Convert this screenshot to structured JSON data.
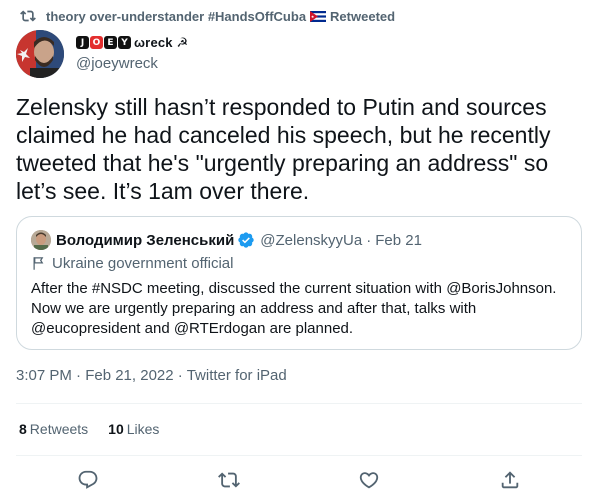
{
  "retweet": {
    "user": "theory over-understander #HandsOffCuba",
    "flag": "cuba-flag",
    "action": "Retweeted",
    "icon": "retweet-icon"
  },
  "author": {
    "name_tiles": [
      "J",
      "O",
      "E",
      "Y"
    ],
    "name_rest": "ωreck ☭",
    "handle": "@joeywreck"
  },
  "tweet": {
    "text": "Zelensky still hasn’t responded to Putin and sources claimed he had canceled his speech, but he recently tweeted that he's \"urgently preparing an address\" so let’s see. It’s 1am over there."
  },
  "quote": {
    "name": "Володимир Зеленський",
    "handle": "@ZelenskyyUa",
    "separator": "·",
    "date": "Feb 21",
    "label": "Ukraine government official",
    "text": "After the #NSDC meeting, discussed the current situation with @BorisJohnson. Now we are urgently preparing an address and after that, talks with @eucopresident and @RTErdogan are planned."
  },
  "meta": {
    "time": "3:07 PM",
    "separator": "·",
    "date": "Feb 21, 2022",
    "source": "Twitter for iPad"
  },
  "stats": {
    "retweets_count": "8",
    "retweets_label": "Retweets",
    "likes_count": "10",
    "likes_label": "Likes"
  },
  "actions": [
    "reply-icon",
    "retweet-icon",
    "like-icon",
    "share-icon"
  ],
  "colors": {
    "secondary_text": "#536471",
    "primary_text": "#0f1419",
    "border": "#cfd9de",
    "verified": "#1d9bf0"
  }
}
